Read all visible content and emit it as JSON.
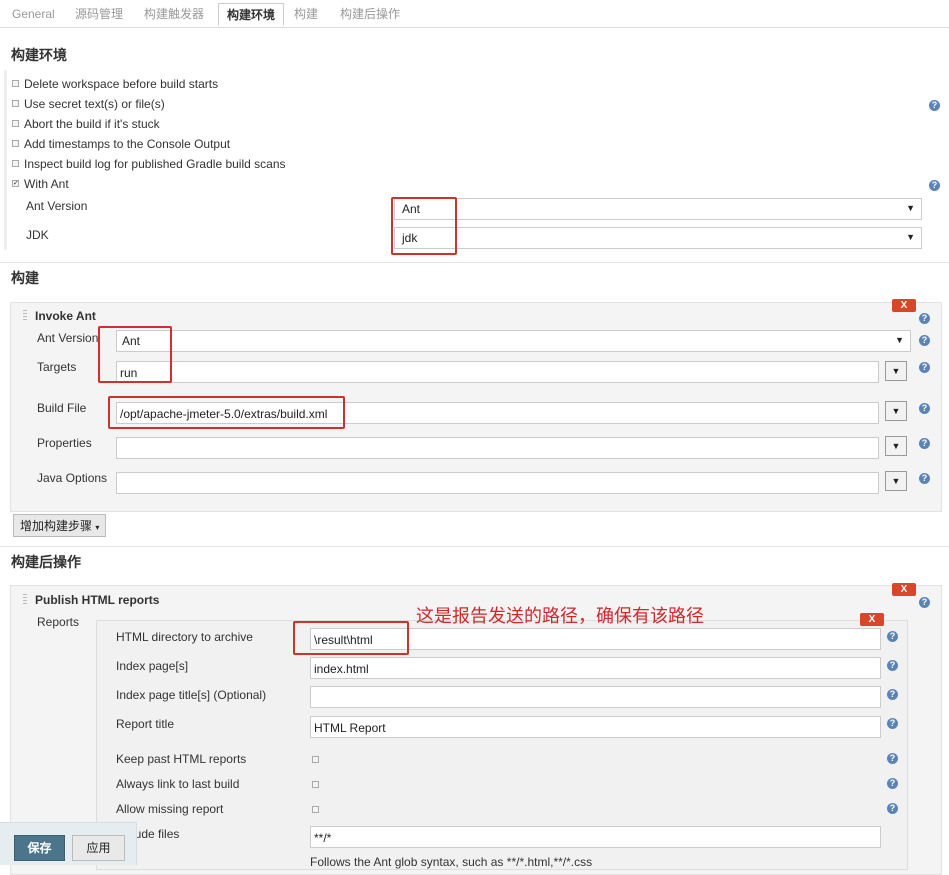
{
  "tabs": [
    {
      "label": "General"
    },
    {
      "label": "源码管理"
    },
    {
      "label": "构建触发器"
    },
    {
      "label": "构建环境"
    },
    {
      "label": "构建"
    },
    {
      "label": "构建后操作"
    }
  ],
  "build_env": {
    "title": "构建环境",
    "options": [
      {
        "label": "Delete workspace before build starts",
        "checked": false
      },
      {
        "label": "Use secret text(s) or file(s)",
        "checked": false
      },
      {
        "label": "Abort the build if it's stuck",
        "checked": false
      },
      {
        "label": "Add timestamps to the Console Output",
        "checked": false
      },
      {
        "label": "Inspect build log for published Gradle build scans",
        "checked": false
      },
      {
        "label": "With Ant",
        "checked": true
      }
    ],
    "ant_version_label": "Ant Version",
    "ant_version_value": "Ant",
    "jdk_label": "JDK",
    "jdk_value": "jdk"
  },
  "build": {
    "title": "构建",
    "step_title": "Invoke Ant",
    "delete_label": "X",
    "ant_version_label": "Ant Version",
    "ant_version_value": "Ant",
    "targets_label": "Targets",
    "targets_value": "run",
    "build_file_label": "Build File",
    "build_file_value": "/opt/apache-jmeter-5.0/extras/build.xml",
    "properties_label": "Properties",
    "properties_value": "",
    "java_options_label": "Java Options",
    "java_options_value": "",
    "add_step_label": "增加构建步骤"
  },
  "post_build": {
    "title": "构建后操作",
    "step_title": "Publish HTML reports",
    "delete_label": "X",
    "reports_label": "Reports",
    "annotation": "这是报告发送的路径，确保有该路径",
    "report_delete_label": "X",
    "html_dir_label": "HTML directory to archive",
    "html_dir_value": "\\result\\html",
    "index_page_label": "Index page[s]",
    "index_page_value": "index.html",
    "index_title_label": "Index page title[s] (Optional)",
    "index_title_value": "",
    "report_title_label": "Report title",
    "report_title_value": "HTML Report",
    "keep_past_label": "Keep past HTML reports",
    "always_link_label": "Always link to last build",
    "allow_missing_label": "Allow missing report",
    "include_files_label": "Include files",
    "include_files_value": "**/*",
    "glob_hint": "Follows the Ant glob syntax, such as **/*.html,**/*.css"
  },
  "footer": {
    "save_label": "保存",
    "apply_label": "应用"
  },
  "colors": {
    "accent_red": "#d32f2f",
    "save_blue": "#4b758b",
    "help_blue": "#5b84b6"
  }
}
